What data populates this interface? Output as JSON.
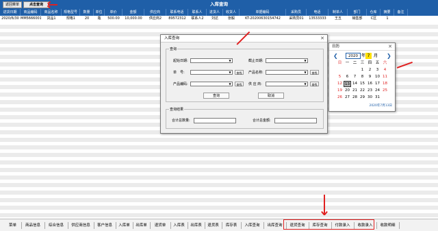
{
  "topbar": {
    "btn_back": "返回菜单",
    "btn_query": "点击查询",
    "title": "入库查询"
  },
  "columns": [
    "进货日期",
    "商品编码",
    "商品名称",
    "规格型号",
    "数量",
    "单位",
    "单价",
    "金额",
    "供应商",
    "联系电话",
    "联系人",
    "进货人",
    "收货人",
    "单据编码",
    "采购员",
    "电话",
    "制单人",
    "部门",
    "仓库",
    "摘要",
    "备注"
  ],
  "row": [
    "2020/6/30",
    "MM5666001",
    "货品1",
    "规格1",
    "20",
    "瓶",
    "500.00",
    "10,000.00",
    "供应商2",
    "89572312",
    "联系人2",
    "刘达",
    "张毅",
    "KT-20200630154742",
    "采购员01",
    "13533333",
    "王五",
    "销售部",
    "C区",
    "1",
    ""
  ],
  "dialog": {
    "title": "入库查询",
    "close": "✕",
    "group_query": "查询",
    "start_date": "起始日期:",
    "end_date": "截止日期:",
    "bill_no": "单　号:",
    "product_name": "产品名称:",
    "product_code": "产品编码:",
    "supplier": "供 应 商:",
    "select_btn": "查找",
    "query_btn": "查询",
    "cancel_btn": "取消",
    "group_result": "查询结果",
    "total_qty": "合计总数量:",
    "total_amount": "合计总金额:"
  },
  "calendar": {
    "title": "日历",
    "close": "✕",
    "year": "2020",
    "year_label": "年",
    "month": "7",
    "month_label": "月",
    "weekdays": [
      "日",
      "一",
      "二",
      "三",
      "四",
      "五",
      "六"
    ],
    "days": [
      "",
      "",
      "",
      "1",
      "2",
      "3",
      "4",
      "5",
      "6",
      "7",
      "8",
      "9",
      "10",
      "11",
      "12",
      "13",
      "14",
      "15",
      "16",
      "17",
      "18",
      "19",
      "20",
      "21",
      "22",
      "23",
      "24",
      "25",
      "26",
      "27",
      "28",
      "29",
      "30",
      "31",
      ""
    ],
    "selected_day": "13",
    "footer": "2020年7月13日"
  },
  "tabs": [
    "菜单",
    "商品信息",
    "综合信息",
    "供应商信息",
    "客户信息",
    "入库单",
    "出库单",
    "退货单",
    "入库表",
    "出库表",
    "退货表",
    "库存表",
    "入库查询",
    "出库查询",
    "退货查询",
    "库存查询",
    "付款录入",
    "收款录入",
    "收款明细"
  ],
  "colors": {
    "header_blue": "#1f5fa8",
    "accent_red": "#e02020",
    "today_yellow": "#ffe000"
  }
}
